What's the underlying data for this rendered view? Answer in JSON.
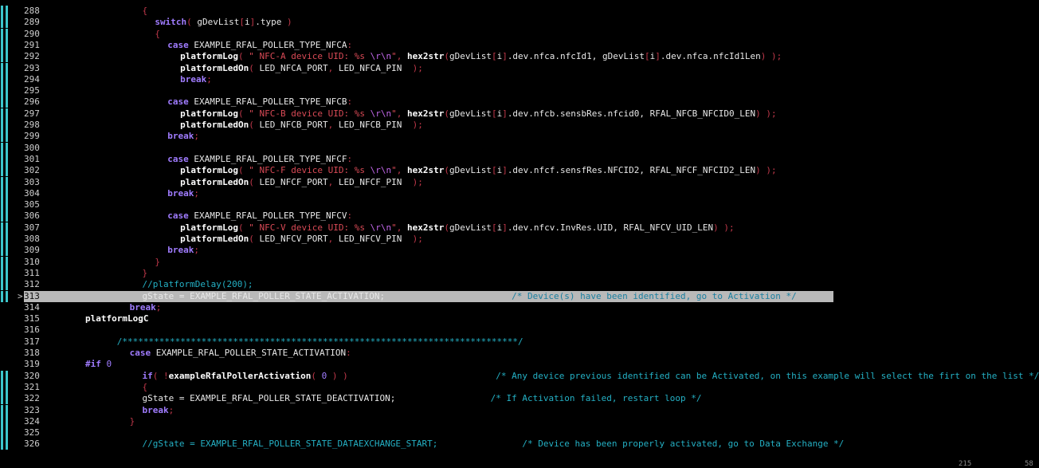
{
  "editor": {
    "current_line": 313,
    "lines": [
      {
        "n": "288",
        "indent": "                  ",
        "tokens": [
          [
            "pu",
            "{"
          ]
        ]
      },
      {
        "n": "289",
        "indent": "                      ",
        "tokens": [
          [
            "kw",
            "switch"
          ],
          [
            "pu",
            "( "
          ],
          [
            "id",
            "gDevList"
          ],
          [
            "pu",
            "["
          ],
          [
            "id",
            "i"
          ],
          [
            "pu",
            "]"
          ],
          [
            "id",
            "."
          ],
          [
            "id",
            "type"
          ],
          [
            "pu",
            " )"
          ]
        ]
      },
      {
        "n": "290",
        "indent": "                      ",
        "tokens": [
          [
            "pu",
            "{"
          ]
        ]
      },
      {
        "n": "291",
        "indent": "                          ",
        "tokens": [
          [
            "kw",
            "case"
          ],
          [
            "id",
            " EXAMPLE_RFAL_POLLER_TYPE_NFCA"
          ],
          [
            "pu",
            ":"
          ]
        ]
      },
      {
        "n": "292",
        "indent": "                              ",
        "tokens": [
          [
            "fn",
            "platformLog"
          ],
          [
            "pu",
            "( "
          ],
          [
            "str",
            "\" NFC-A device UID: %s "
          ],
          [
            "esc",
            "\\r\\n"
          ],
          [
            "str",
            "\""
          ],
          [
            "pu",
            ", "
          ],
          [
            "fn",
            "hex2str"
          ],
          [
            "pu",
            "("
          ],
          [
            "id",
            "gDevList"
          ],
          [
            "pu",
            "["
          ],
          [
            "id",
            "i"
          ],
          [
            "pu",
            "]"
          ],
          [
            "id",
            ".dev.nfca.nfcId1, gDevList"
          ],
          [
            "pu",
            "["
          ],
          [
            "id",
            "i"
          ],
          [
            "pu",
            "]"
          ],
          [
            "id",
            ".dev.nfca.nfcId1Len"
          ],
          [
            "pu",
            ") );"
          ]
        ]
      },
      {
        "n": "293",
        "indent": "                              ",
        "tokens": [
          [
            "fn",
            "platformLedOn"
          ],
          [
            "pu",
            "( "
          ],
          [
            "id",
            "LED_NFCA_PORT"
          ],
          [
            "pu",
            ", "
          ],
          [
            "id",
            "LED_NFCA_PIN"
          ],
          [
            "pu",
            "  );"
          ]
        ]
      },
      {
        "n": "294",
        "indent": "                              ",
        "tokens": [
          [
            "kw",
            "break"
          ],
          [
            "pu",
            ";"
          ]
        ]
      },
      {
        "n": "295",
        "indent": "",
        "tokens": []
      },
      {
        "n": "296",
        "indent": "                          ",
        "tokens": [
          [
            "kw",
            "case"
          ],
          [
            "id",
            " EXAMPLE_RFAL_POLLER_TYPE_NFCB"
          ],
          [
            "pu",
            ":"
          ]
        ]
      },
      {
        "n": "297",
        "indent": "                              ",
        "tokens": [
          [
            "fn",
            "platformLog"
          ],
          [
            "pu",
            "( "
          ],
          [
            "str",
            "\" NFC-B device UID: %s "
          ],
          [
            "esc",
            "\\r\\n"
          ],
          [
            "str",
            "\""
          ],
          [
            "pu",
            ", "
          ],
          [
            "fn",
            "hex2str"
          ],
          [
            "pu",
            "("
          ],
          [
            "id",
            "gDevList"
          ],
          [
            "pu",
            "["
          ],
          [
            "id",
            "i"
          ],
          [
            "pu",
            "]"
          ],
          [
            "id",
            ".dev.nfcb.sensbRes.nfcid0, RFAL_NFCB_NFCID0_LEN"
          ],
          [
            "pu",
            ") );"
          ]
        ]
      },
      {
        "n": "298",
        "indent": "                              ",
        "tokens": [
          [
            "fn",
            "platformLedOn"
          ],
          [
            "pu",
            "( "
          ],
          [
            "id",
            "LED_NFCB_PORT"
          ],
          [
            "pu",
            ", "
          ],
          [
            "id",
            "LED_NFCB_PIN"
          ],
          [
            "pu",
            "  );"
          ]
        ]
      },
      {
        "n": "299",
        "indent": "                          ",
        "tokens": [
          [
            "kw",
            "break"
          ],
          [
            "pu",
            ";"
          ]
        ]
      },
      {
        "n": "300",
        "indent": "",
        "tokens": []
      },
      {
        "n": "301",
        "indent": "                          ",
        "tokens": [
          [
            "kw",
            "case"
          ],
          [
            "id",
            " EXAMPLE_RFAL_POLLER_TYPE_NFCF"
          ],
          [
            "pu",
            ":"
          ]
        ]
      },
      {
        "n": "302",
        "indent": "                              ",
        "tokens": [
          [
            "fn",
            "platformLog"
          ],
          [
            "pu",
            "( "
          ],
          [
            "str",
            "\" NFC-F device UID: %s "
          ],
          [
            "esc",
            "\\r\\n"
          ],
          [
            "str",
            "\""
          ],
          [
            "pu",
            ", "
          ],
          [
            "fn",
            "hex2str"
          ],
          [
            "pu",
            "("
          ],
          [
            "id",
            "gDevList"
          ],
          [
            "pu",
            "["
          ],
          [
            "id",
            "i"
          ],
          [
            "pu",
            "]"
          ],
          [
            "id",
            ".dev.nfcf.sensfRes.NFCID2, RFAL_NFCF_NFCID2_LEN"
          ],
          [
            "pu",
            ") );"
          ]
        ]
      },
      {
        "n": "303",
        "indent": "                              ",
        "tokens": [
          [
            "fn",
            "platformLedOn"
          ],
          [
            "pu",
            "( "
          ],
          [
            "id",
            "LED_NFCF_PORT"
          ],
          [
            "pu",
            ", "
          ],
          [
            "id",
            "LED_NFCF_PIN"
          ],
          [
            "pu",
            "  );"
          ]
        ]
      },
      {
        "n": "304",
        "indent": "                          ",
        "tokens": [
          [
            "kw",
            "break"
          ],
          [
            "pu",
            ";"
          ]
        ]
      },
      {
        "n": "305",
        "indent": "",
        "tokens": []
      },
      {
        "n": "306",
        "indent": "                          ",
        "tokens": [
          [
            "kw",
            "case"
          ],
          [
            "id",
            " EXAMPLE_RFAL_POLLER_TYPE_NFCV"
          ],
          [
            "pu",
            ":"
          ]
        ]
      },
      {
        "n": "307",
        "indent": "                              ",
        "tokens": [
          [
            "fn",
            "platformLog"
          ],
          [
            "pu",
            "( "
          ],
          [
            "str",
            "\" NFC-V device UID: %s "
          ],
          [
            "esc",
            "\\r\\n"
          ],
          [
            "str",
            "\""
          ],
          [
            "pu",
            ", "
          ],
          [
            "fn",
            "hex2str"
          ],
          [
            "pu",
            "("
          ],
          [
            "id",
            "gDevList"
          ],
          [
            "pu",
            "["
          ],
          [
            "id",
            "i"
          ],
          [
            "pu",
            "]"
          ],
          [
            "id",
            ".dev.nfcv.InvRes.UID, RFAL_NFCV_UID_LEN"
          ],
          [
            "pu",
            ") );"
          ]
        ]
      },
      {
        "n": "308",
        "indent": "                              ",
        "tokens": [
          [
            "fn",
            "platformLedOn"
          ],
          [
            "pu",
            "( "
          ],
          [
            "id",
            "LED_NFCV_PORT"
          ],
          [
            "pu",
            ", "
          ],
          [
            "id",
            "LED_NFCV_PIN"
          ],
          [
            "pu",
            "  );"
          ]
        ]
      },
      {
        "n": "309",
        "indent": "                          ",
        "tokens": [
          [
            "kw",
            "break"
          ],
          [
            "pu",
            ";"
          ]
        ]
      },
      {
        "n": "310",
        "indent": "                      ",
        "tokens": [
          [
            "pu",
            "}"
          ]
        ]
      },
      {
        "n": "311",
        "indent": "                  ",
        "tokens": [
          [
            "pu",
            "}"
          ]
        ]
      },
      {
        "n": "312",
        "indent": "                  ",
        "tokens": [
          [
            "cm",
            "//platformDelay(200);"
          ]
        ]
      },
      {
        "n": "313",
        "indent": "                  ",
        "tokens": [
          [
            "id",
            "gState = EXAMPLE_RFAL_POLLER_STATE_ACTIVATION;"
          ],
          [
            "id",
            "                        "
          ],
          [
            "cm",
            "/* Device(s) have been identified, go to Activation */"
          ]
        ]
      },
      {
        "n": "314",
        "indent": "              ",
        "tokens": [
          [
            "kw",
            "break"
          ],
          [
            "pu",
            ";"
          ]
        ]
      },
      {
        "n": "315",
        "indent": "",
        "tokens": [
          [
            "fn",
            "platformLogC"
          ]
        ]
      },
      {
        "n": "316",
        "indent": "",
        "tokens": []
      },
      {
        "n": "317",
        "indent": "          ",
        "tokens": [
          [
            "cm",
            "/***************************************************************************/"
          ]
        ]
      },
      {
        "n": "318",
        "indent": "              ",
        "tokens": [
          [
            "kw",
            "case"
          ],
          [
            "id",
            " EXAMPLE_RFAL_POLLER_STATE_ACTIVATION"
          ],
          [
            "pu",
            ":"
          ]
        ]
      },
      {
        "n": "319",
        "indent": "",
        "tokens": [
          [
            "pp",
            "#if"
          ],
          [
            "num",
            " 0"
          ]
        ]
      },
      {
        "n": "320",
        "indent": "                  ",
        "tokens": [
          [
            "kw",
            "if"
          ],
          [
            "pu",
            "( !"
          ],
          [
            "fn",
            "exampleRfalPollerActivation"
          ],
          [
            "pu",
            "( "
          ],
          [
            "num",
            "0"
          ],
          [
            "pu",
            " ) )"
          ],
          [
            "id",
            "                            "
          ],
          [
            "cm",
            "/* Any device previous identified can be Activated, on this example will select the firt on the list */"
          ]
        ]
      },
      {
        "n": "321",
        "indent": "                  ",
        "tokens": [
          [
            "pu",
            "{"
          ]
        ]
      },
      {
        "n": "322",
        "indent": "                  ",
        "tokens": [
          [
            "id",
            "gState = EXAMPLE_RFAL_POLLER_STATE_DEACTIVATION;"
          ],
          [
            "id",
            "                  "
          ],
          [
            "cm",
            "/* If Activation failed, restart loop */"
          ]
        ]
      },
      {
        "n": "323",
        "indent": "                  ",
        "tokens": [
          [
            "kw",
            "break"
          ],
          [
            "pu",
            ";"
          ]
        ]
      },
      {
        "n": "324",
        "indent": "              ",
        "tokens": [
          [
            "pu",
            "}"
          ]
        ]
      },
      {
        "n": "325",
        "indent": "",
        "tokens": []
      },
      {
        "n": "326",
        "indent": "                  ",
        "tokens": [
          [
            "cm",
            "//gState = EXAMPLE_RFAL_POLLER_STATE_DATAEXCHANGE_START;"
          ],
          [
            "id",
            "                "
          ],
          [
            "cm",
            "/* Device has been properly activated, go to Data Exchange */"
          ]
        ]
      }
    ],
    "gutter_marks": [
      "288",
      "289",
      "290",
      "291",
      "292",
      "293",
      "294",
      "295",
      "296",
      "297",
      "298",
      "299",
      "300",
      "301",
      "302",
      "303",
      "304",
      "305",
      "306",
      "307",
      "308",
      "309",
      "310",
      "311",
      "312",
      "313",
      "320",
      "321",
      "322",
      "323",
      "324",
      "325",
      "326"
    ],
    "current_marker": ">"
  },
  "status": {
    "left_hint": "215",
    "right_hint": "58"
  },
  "colors": {
    "background": "#000000",
    "line_number": "#cfcfcf",
    "keyword": "#a07cff",
    "string": "#d94a56",
    "comment": "#24b0c4",
    "gutter_bar": "#3cc6cc",
    "current_line_highlight": "#b9b9b9"
  }
}
